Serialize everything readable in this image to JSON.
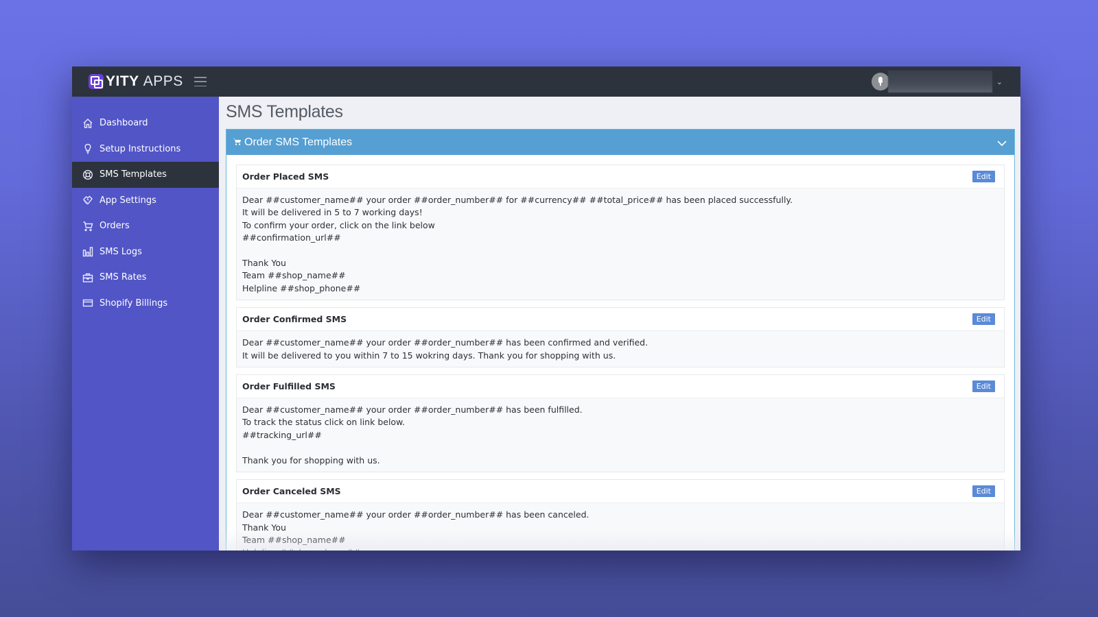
{
  "topbar": {
    "brand_strong": "YITY",
    "brand_light": "APPS",
    "user_name": "",
    "caret": "⌄"
  },
  "sidebar": {
    "items": [
      {
        "label": "Dashboard",
        "icon": "home-icon",
        "active": false
      },
      {
        "label": "Setup Instructions",
        "icon": "lightbulb-icon",
        "active": false
      },
      {
        "label": "SMS Templates",
        "icon": "lifebuoy-icon",
        "active": true
      },
      {
        "label": "App Settings",
        "icon": "handshake-icon",
        "active": false
      },
      {
        "label": "Orders",
        "icon": "cart-icon",
        "active": false
      },
      {
        "label": "SMS Logs",
        "icon": "bar-chart-icon",
        "active": false
      },
      {
        "label": "SMS Rates",
        "icon": "briefcase-icon",
        "active": false
      },
      {
        "label": "Shopify Billings",
        "icon": "credit-card-icon",
        "active": false
      }
    ]
  },
  "main": {
    "page_title": "SMS Templates",
    "panel": {
      "title": "Order SMS Templates",
      "icon": "cart-icon",
      "colors": {
        "header": "#559fd3",
        "edit_button": "#5b8ad6",
        "sidebar": "#5255c6",
        "topbar": "#2d333d"
      },
      "templates": [
        {
          "title": "Order Placed SMS",
          "edit_label": "Edit",
          "body": "Dear ##customer_name## your order ##order_number## for ##currency## ##total_price## has been placed successfully.\nIt will be delivered in 5 to 7 working days!\nTo confirm your order, click on the link below\n##confirmation_url##\n\nThank You\nTeam ##shop_name##\nHelpline ##shop_phone##"
        },
        {
          "title": "Order Confirmed SMS",
          "edit_label": "Edit",
          "body": "Dear ##customer_name## your order ##order_number## has been confirmed and verified.\nIt will be delivered to you within 7 to 15 wokring days. Thank you for shopping with us."
        },
        {
          "title": "Order Fulfilled SMS",
          "edit_label": "Edit",
          "body": "Dear ##customer_name## your order ##order_number## has been fulfilled.\nTo track the status click on link below.\n##tracking_url##\n\nThank you for shopping with us."
        },
        {
          "title": "Order Canceled SMS",
          "edit_label": "Edit",
          "body": "Dear ##customer_name## your order ##order_number## has been canceled.\nThank You\nTeam ##shop_name##\nHelpline ##shop_phone##"
        }
      ]
    }
  }
}
